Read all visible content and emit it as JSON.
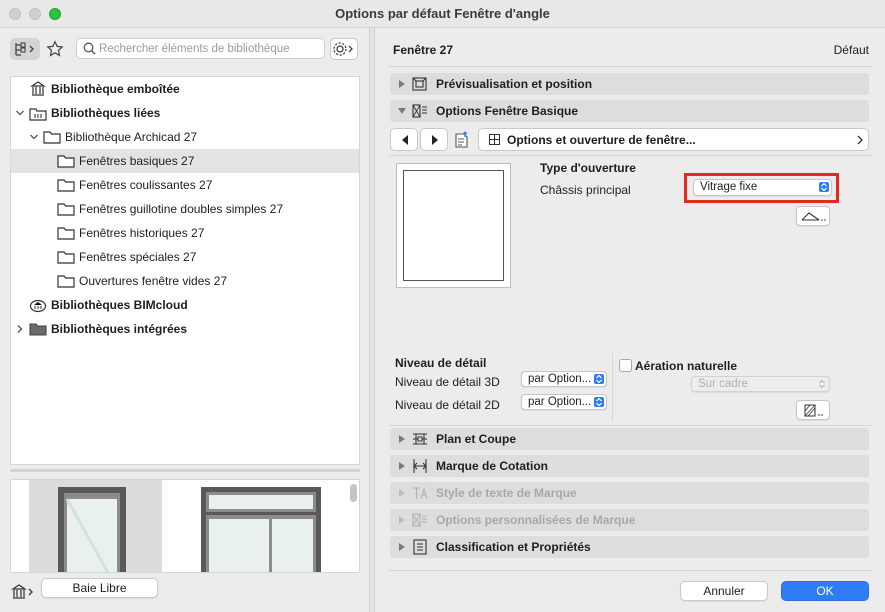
{
  "window": {
    "title": "Options par défaut Fenêtre d'angle"
  },
  "search": {
    "placeholder": "Rechercher éléments de bibliothèque"
  },
  "tree": [
    {
      "label": "Bibliothèque emboîtée",
      "bold": true,
      "icon": "library-embedded-icon"
    },
    {
      "label": "Bibliothèques liées",
      "bold": true,
      "icon": "library-linked-icon",
      "expanded": true
    },
    {
      "label": "Bibliothèque Archicad 27",
      "bold": false,
      "icon": "folder-icon",
      "expanded": true
    },
    {
      "label": "Fenêtres basiques 27",
      "bold": false,
      "icon": "folder-icon",
      "selected": true
    },
    {
      "label": "Fenêtres coulissantes 27",
      "bold": false,
      "icon": "folder-icon"
    },
    {
      "label": "Fenêtres guillotine doubles simples 27",
      "bold": false,
      "icon": "folder-icon"
    },
    {
      "label": "Fenêtres historiques 27",
      "bold": false,
      "icon": "folder-icon"
    },
    {
      "label": "Fenêtres spéciales 27",
      "bold": false,
      "icon": "folder-icon"
    },
    {
      "label": "Ouvertures fenêtre vides 27",
      "bold": false,
      "icon": "folder-icon"
    },
    {
      "label": "Bibliothèques BIMcloud",
      "bold": true,
      "icon": "bimcloud-icon"
    },
    {
      "label": "Bibliothèques intégrées",
      "bold": true,
      "icon": "folder-dark-icon",
      "expanded": false
    }
  ],
  "bottom": {
    "object_name": "Baie Libre"
  },
  "panel": {
    "element_name": "Fenêtre 27",
    "default_label": "Défaut",
    "sections": {
      "preview": "Prévisualisation et position",
      "basic": "Options Fenêtre Basique",
      "plan": "Plan et Coupe",
      "dimension": "Marque de Cotation",
      "text_style": "Style de texte de Marque",
      "custom": "Options personnalisées de Marque",
      "classification": "Classification et Propriétés"
    },
    "page_selector": "Options et ouverture de fenêtre...",
    "opening_type_heading": "Type d'ouverture",
    "main_sash_label": "Châssis principal",
    "main_sash_value": "Vitrage fixe",
    "detail_heading": "Niveau de détail",
    "detail_3d_label": "Niveau de détail 3D",
    "detail_3d_value": "par Option...",
    "detail_2d_label": "Niveau de détail 2D",
    "detail_2d_value": "par Option...",
    "ventilation_label": "Aération naturelle",
    "ventilation_value": "Sur cadre",
    "ventilation_checked": false
  },
  "buttons": {
    "cancel": "Annuler",
    "ok": "OK"
  },
  "colors": {
    "accent": "#2f7cf6",
    "highlight_box": "#e12a20"
  }
}
